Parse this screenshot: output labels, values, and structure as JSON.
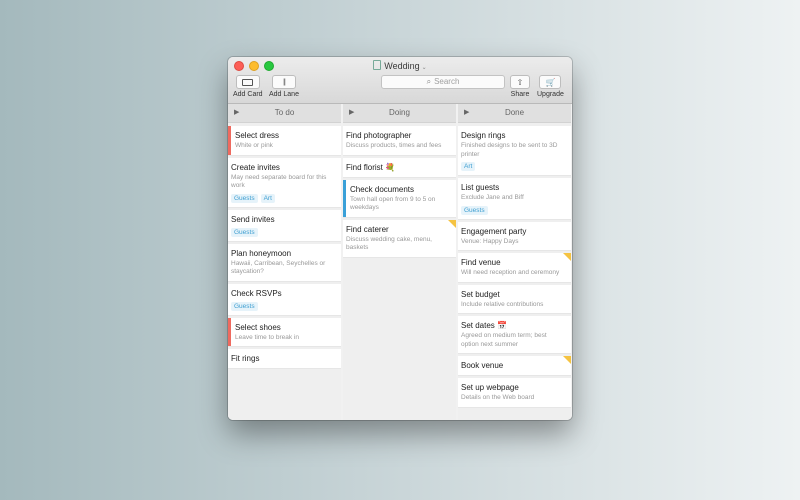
{
  "window": {
    "title": "Wedding",
    "chevron": "⌄"
  },
  "toolbar": {
    "add_card_label": "Add Card",
    "add_lane_label": "Add Lane",
    "search_placeholder": "Search",
    "share_label": "Share",
    "upgrade_label": "Upgrade"
  },
  "colors": {
    "tag_text": "#3f9fd1",
    "red_stripe": "#ee6a5f",
    "blue_stripe": "#3aa0d8",
    "note_corner": "#f5c342"
  },
  "lanes": [
    {
      "title": "To do",
      "cards": [
        {
          "title": "Select dress",
          "desc": "White or pink",
          "tags": [],
          "stripe": "#ee6a5f",
          "note": false
        },
        {
          "title": "Create invites",
          "desc": "May need separate board for this work",
          "tags": [
            "Guests",
            "Art"
          ],
          "stripe": "",
          "note": false
        },
        {
          "title": "Send invites",
          "desc": "",
          "tags": [
            "Guests"
          ],
          "stripe": "",
          "note": false
        },
        {
          "title": "Plan honeymoon",
          "desc": "Hawaii, Carribean, Seychelles or staycation?",
          "tags": [],
          "stripe": "",
          "note": false
        },
        {
          "title": "Check RSVPs",
          "desc": "",
          "tags": [
            "Guests"
          ],
          "stripe": "",
          "note": false
        },
        {
          "title": "Select shoes",
          "desc": "Leave time to break in",
          "tags": [],
          "stripe": "#ee6a5f",
          "note": false
        },
        {
          "title": "Fit rings",
          "desc": "",
          "tags": [],
          "stripe": "",
          "note": false
        }
      ]
    },
    {
      "title": "Doing",
      "cards": [
        {
          "title": "Find photographer",
          "desc": "Discuss products, times and fees",
          "tags": [],
          "stripe": "",
          "note": false
        },
        {
          "title": "Find florist 💐",
          "desc": "",
          "tags": [],
          "stripe": "",
          "note": false
        },
        {
          "title": "Check documents",
          "desc": "Town hall open from 9 to 5 on weekdays",
          "tags": [],
          "stripe": "#3aa0d8",
          "note": false
        },
        {
          "title": "Find caterer",
          "desc": "Discuss wedding cake, menu, baskets",
          "tags": [],
          "stripe": "",
          "note": true
        }
      ]
    },
    {
      "title": "Done",
      "cards": [
        {
          "title": "Design rings",
          "desc": "Finished designs to be sent to 3D printer",
          "tags": [
            "Art"
          ],
          "stripe": "",
          "note": false
        },
        {
          "title": "List guests",
          "desc": "Exclude Jane and Biff",
          "tags": [
            "Guests"
          ],
          "stripe": "",
          "note": false
        },
        {
          "title": "Engagement party",
          "desc": "Venue: Happy Days",
          "tags": [],
          "stripe": "",
          "note": false
        },
        {
          "title": "Find venue",
          "desc": "Will need reception and ceremony",
          "tags": [],
          "stripe": "",
          "note": true
        },
        {
          "title": "Set budget",
          "desc": "Include relative contributions",
          "tags": [],
          "stripe": "",
          "note": false
        },
        {
          "title": "Set dates 📅",
          "desc": "Agreed on medium term; best option next summer",
          "tags": [],
          "stripe": "",
          "note": false
        },
        {
          "title": "Book venue",
          "desc": "",
          "tags": [],
          "stripe": "",
          "note": true
        },
        {
          "title": "Set up webpage",
          "desc": "Details on the Web board",
          "tags": [],
          "stripe": "",
          "note": false
        }
      ]
    }
  ]
}
